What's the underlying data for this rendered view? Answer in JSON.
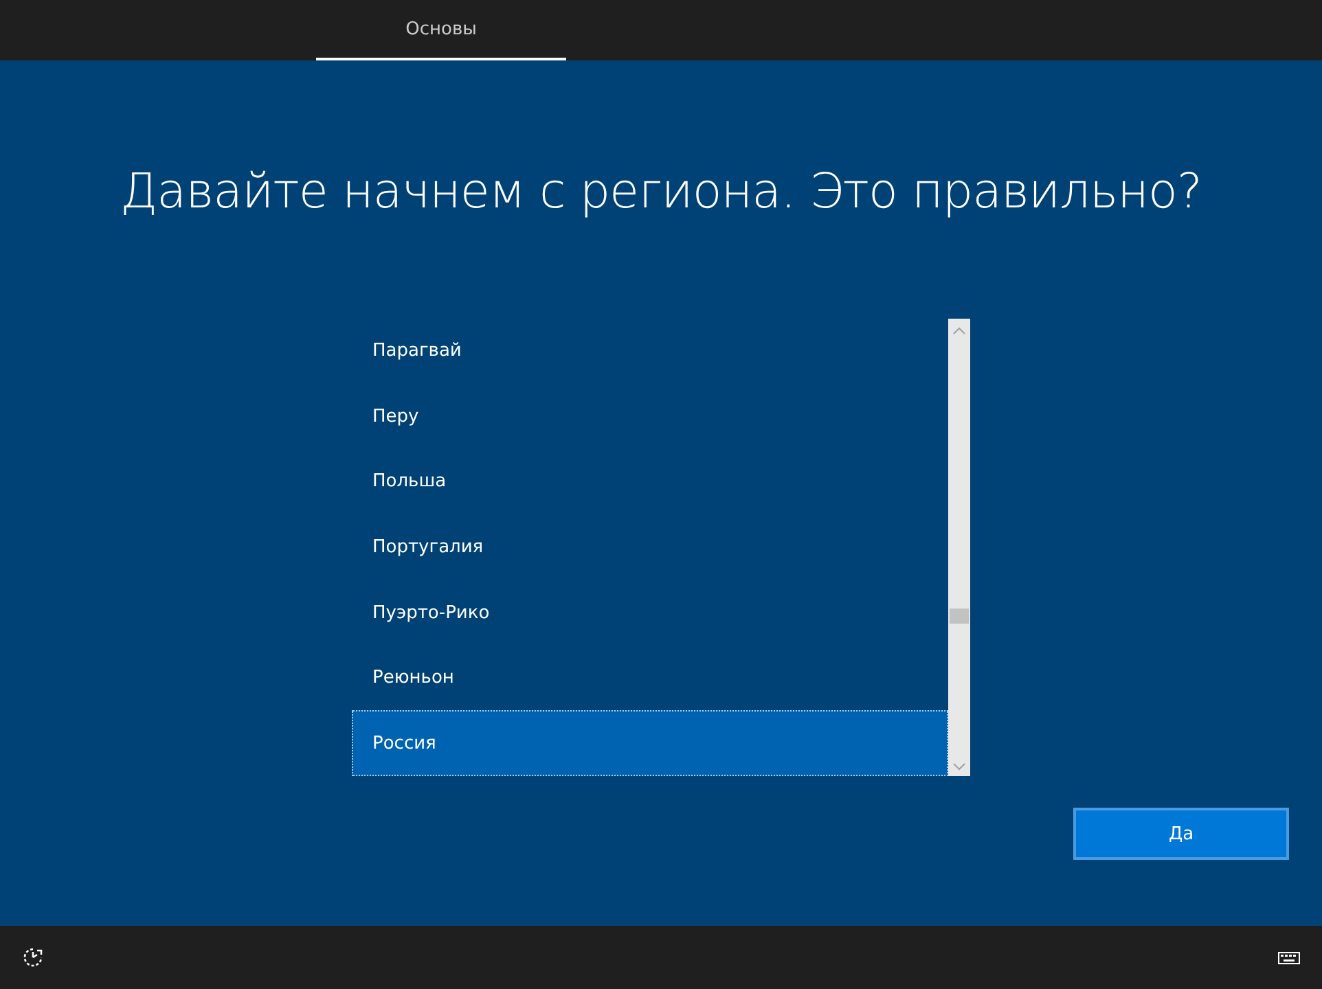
{
  "tabs": [
    {
      "label": "Основы",
      "selected": true
    }
  ],
  "title": "Давайте начнем с региона. Это правильно?",
  "regions": [
    {
      "label": "Парагвай",
      "selected": false
    },
    {
      "label": "Перу",
      "selected": false
    },
    {
      "label": "Польша",
      "selected": false
    },
    {
      "label": "Португалия",
      "selected": false
    },
    {
      "label": "Пуэрто-Рико",
      "selected": false
    },
    {
      "label": "Реюньон",
      "selected": false
    },
    {
      "label": "Россия",
      "selected": true
    }
  ],
  "buttons": [
    {
      "label": "Да"
    }
  ]
}
